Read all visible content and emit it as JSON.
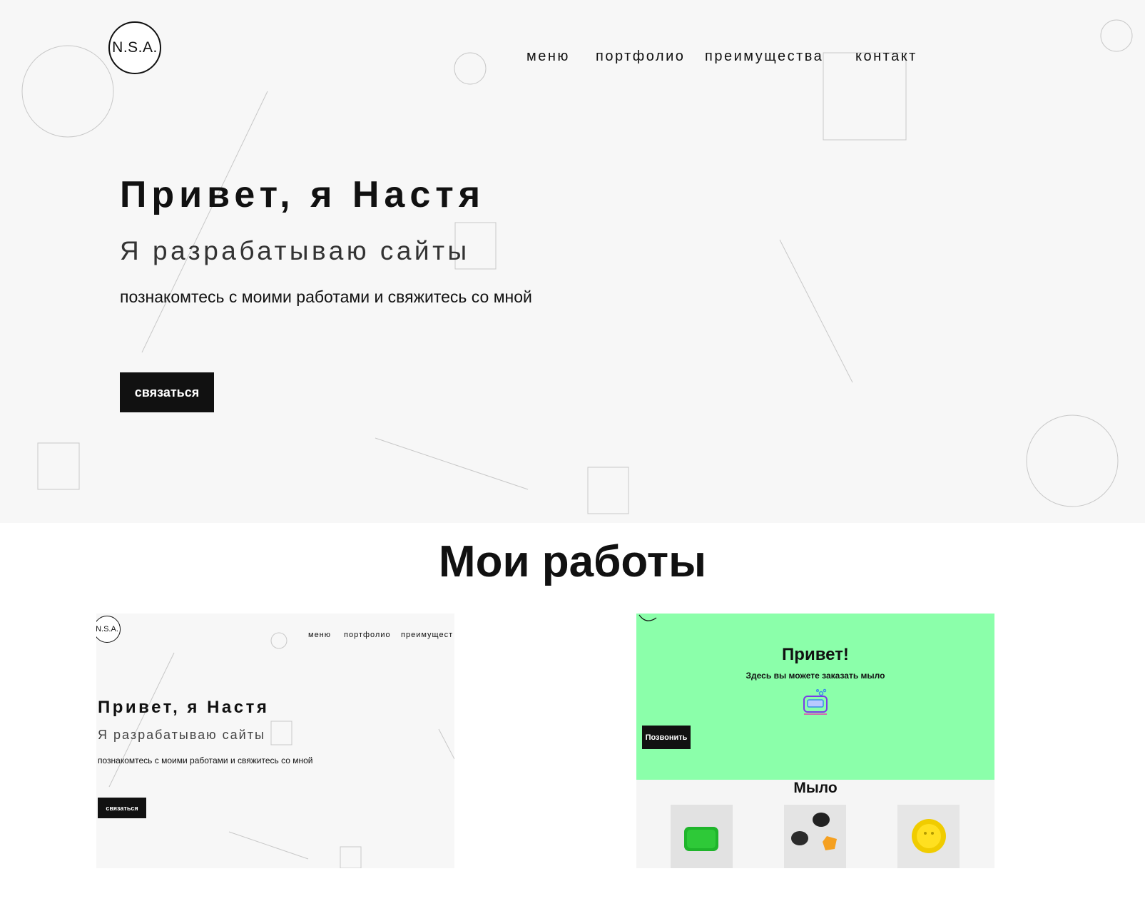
{
  "header": {
    "logo_text": "N.S.A.",
    "nav": [
      "меню",
      "портфолио",
      "преимущества",
      "контакт"
    ]
  },
  "hero": {
    "title": "Привет, я Настя",
    "subtitle": "Я разрабатываю сайты",
    "lead": "познакомтесь с моими работами и свяжитесь со мной",
    "cta_label": "связаться"
  },
  "works": {
    "title": "Мои работы",
    "card1": {
      "logo_text": "N.S.A.",
      "nav": [
        "меню",
        "портфолио",
        "преимущест"
      ],
      "title": "Привет, я Настя",
      "subtitle": "Я разрабатываю сайты",
      "lead": "познакомтесь с моими работами и свяжитесь со мной",
      "cta_label": "связаться"
    },
    "card2": {
      "title": "Привет!",
      "subtitle": "Здесь вы можете заказать мыло",
      "cta_label": "Позвонить",
      "section_title": "Мыло",
      "accent_color": "#8bffaa",
      "products": [
        "green-soap",
        "black-and-orange-soap",
        "yellow-soap"
      ]
    }
  },
  "colors": {
    "hero_bg": "#f7f7f7",
    "text": "#111111",
    "button_bg": "#111111",
    "button_text": "#ffffff",
    "decor_line": "#c8c8c8"
  }
}
